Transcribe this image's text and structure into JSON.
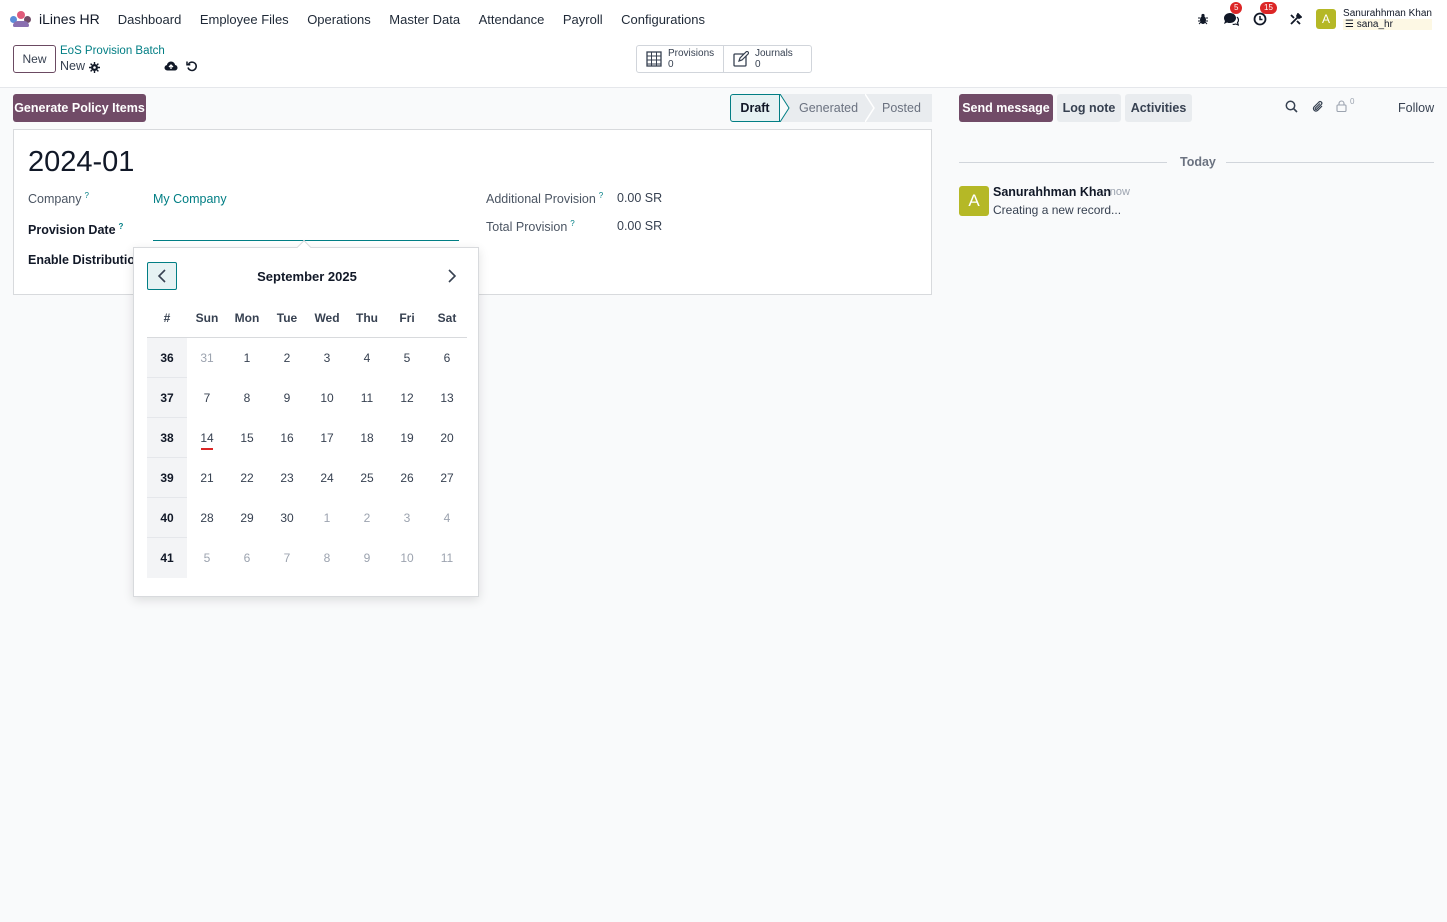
{
  "navbar": {
    "brand": "iLines HR",
    "menu": [
      "Dashboard",
      "Employee Files",
      "Operations",
      "Master Data",
      "Attendance",
      "Payroll",
      "Configurations"
    ],
    "messages_badge": "5",
    "activities_badge": "15",
    "user_initial": "A",
    "user_name": "Sanurahhman Khan",
    "user_db": "sana_hr"
  },
  "control_panel": {
    "new_label": "New",
    "breadcrumb_parent": "EoS Provision Batch",
    "breadcrumb_current": "New",
    "smart_buttons": [
      {
        "label": "Provisions",
        "value": "0",
        "icon": "table-icon"
      },
      {
        "label": "Journals",
        "value": "0",
        "icon": "edit-icon"
      }
    ]
  },
  "header": {
    "action_button": "Generate Policy Items",
    "stages": [
      "Draft",
      "Generated",
      "Posted"
    ],
    "active_stage": "Draft"
  },
  "form": {
    "title": "2024-01",
    "company_label": "Company",
    "company_value": "My Company",
    "provision_date_label": "Provision Date",
    "provision_date_value": "",
    "enable_distribution_label": "Enable Distribution",
    "additional_provision_label": "Additional Provision",
    "additional_provision_value": "0.00 SR",
    "total_provision_label": "Total Provision",
    "total_provision_value": "0.00 SR",
    "help_mark": "?"
  },
  "datepicker": {
    "month_title": "September 2025",
    "headers": [
      "#",
      "Sun",
      "Mon",
      "Tue",
      "Wed",
      "Thu",
      "Fri",
      "Sat"
    ],
    "weeks": [
      {
        "week": "36",
        "days": [
          "31",
          "1",
          "2",
          "3",
          "4",
          "5",
          "6"
        ],
        "muted": [
          true,
          false,
          false,
          false,
          false,
          false,
          false
        ]
      },
      {
        "week": "37",
        "days": [
          "7",
          "8",
          "9",
          "10",
          "11",
          "12",
          "13"
        ],
        "muted": [
          false,
          false,
          false,
          false,
          false,
          false,
          false
        ]
      },
      {
        "week": "38",
        "days": [
          "14",
          "15",
          "16",
          "17",
          "18",
          "19",
          "20"
        ],
        "muted": [
          false,
          false,
          false,
          false,
          false,
          false,
          false
        ]
      },
      {
        "week": "39",
        "days": [
          "21",
          "22",
          "23",
          "24",
          "25",
          "26",
          "27"
        ],
        "muted": [
          false,
          false,
          false,
          false,
          false,
          false,
          false
        ]
      },
      {
        "week": "40",
        "days": [
          "28",
          "29",
          "30",
          "1",
          "2",
          "3",
          "4"
        ],
        "muted": [
          false,
          false,
          false,
          true,
          true,
          true,
          true
        ]
      },
      {
        "week": "41",
        "days": [
          "5",
          "6",
          "7",
          "8",
          "9",
          "10",
          "11"
        ],
        "muted": [
          true,
          true,
          true,
          true,
          true,
          true,
          true
        ]
      }
    ],
    "today": "14"
  },
  "chatter": {
    "send_message": "Send message",
    "log_note": "Log note",
    "activities": "Activities",
    "follower_count": "0",
    "follow": "Follow",
    "date_separator": "Today",
    "message": {
      "avatar": "A",
      "author": "Sanurahhman Khan",
      "time": "- now",
      "body": "Creating a new record..."
    }
  },
  "colors": {
    "primary": "#714b67",
    "accent": "#017e84",
    "avatar": "#b5b826",
    "badge": "#dc2626"
  }
}
